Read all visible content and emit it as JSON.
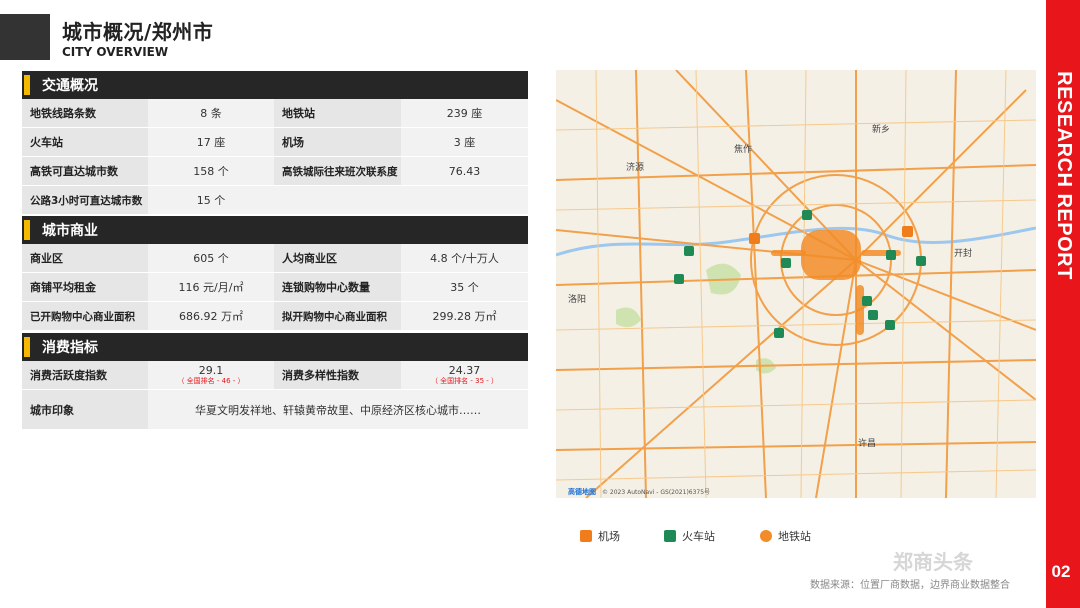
{
  "header": {
    "title": "城市概况/郑州市",
    "subtitle": "CITY OVERVIEW"
  },
  "side": {
    "report_label": "RESEARCH REPORT",
    "page_number": "02"
  },
  "transport": {
    "section_title": "交通概况",
    "rows": [
      {
        "k1": "地铁线路条数",
        "v1": "8 条",
        "k2": "地铁站",
        "v2": "239 座"
      },
      {
        "k1": "火车站",
        "v1": "17 座",
        "k2": "机场",
        "v2": "3 座"
      },
      {
        "k1": "高铁可直达城市数",
        "v1": "158 个",
        "k2": "高铁城际往来班次联系度",
        "v2": "76.43"
      },
      {
        "k1": "公路3小时可直达城市数",
        "v1": "15 个",
        "k2": "",
        "v2": ""
      }
    ]
  },
  "commerce": {
    "section_title": "城市商业",
    "rows": [
      {
        "k1": "商业区",
        "v1": "605 个",
        "k2": "人均商业区",
        "v2": "4.8 个/十万人"
      },
      {
        "k1": "商铺平均租金",
        "v1": "116 元/月/㎡",
        "k2": "连锁购物中心数量",
        "v2": "35 个"
      },
      {
        "k1": "已开购物中心商业面积",
        "v1": "686.92 万㎡",
        "k2": "拟开购物中心商业面积",
        "v2": "299.28 万㎡"
      }
    ]
  },
  "consumption": {
    "section_title": "消费指标",
    "activity_label": "消费活跃度指数",
    "activity_value": "29.1",
    "activity_rank": "（ 全国排名 - 46 - ）",
    "diversity_label": "消费多样性指数",
    "diversity_value": "24.37",
    "diversity_rank": "（ 全国排名 - 35 - ）",
    "impression_label": "城市印象",
    "impression_value": "华夏文明发祥地、轩辕黄帝故里、中原经济区核心城市……"
  },
  "map": {
    "labels": {
      "jiaozuo": "焦作",
      "xinxiang": "新乡",
      "kaifeng": "开封",
      "luoyang": "洛阳",
      "xuchang": "许昌",
      "jiyuan": "济源"
    },
    "attribution": "© 2023 AutoNavi - GS(2021)6375号",
    "brand": "高德地图"
  },
  "legend": {
    "airport": "机场",
    "train": "火车站",
    "metro": "地铁站"
  },
  "colors": {
    "accent": "#e8151b",
    "section_bar": "#f5b800",
    "airport": "#f07d1c",
    "train": "#1f8a55",
    "metro": "#f28c28"
  },
  "footer": {
    "watermark": "郑商头条",
    "source": "数据来源：位置厂商数据，边界商业数据整合"
  }
}
